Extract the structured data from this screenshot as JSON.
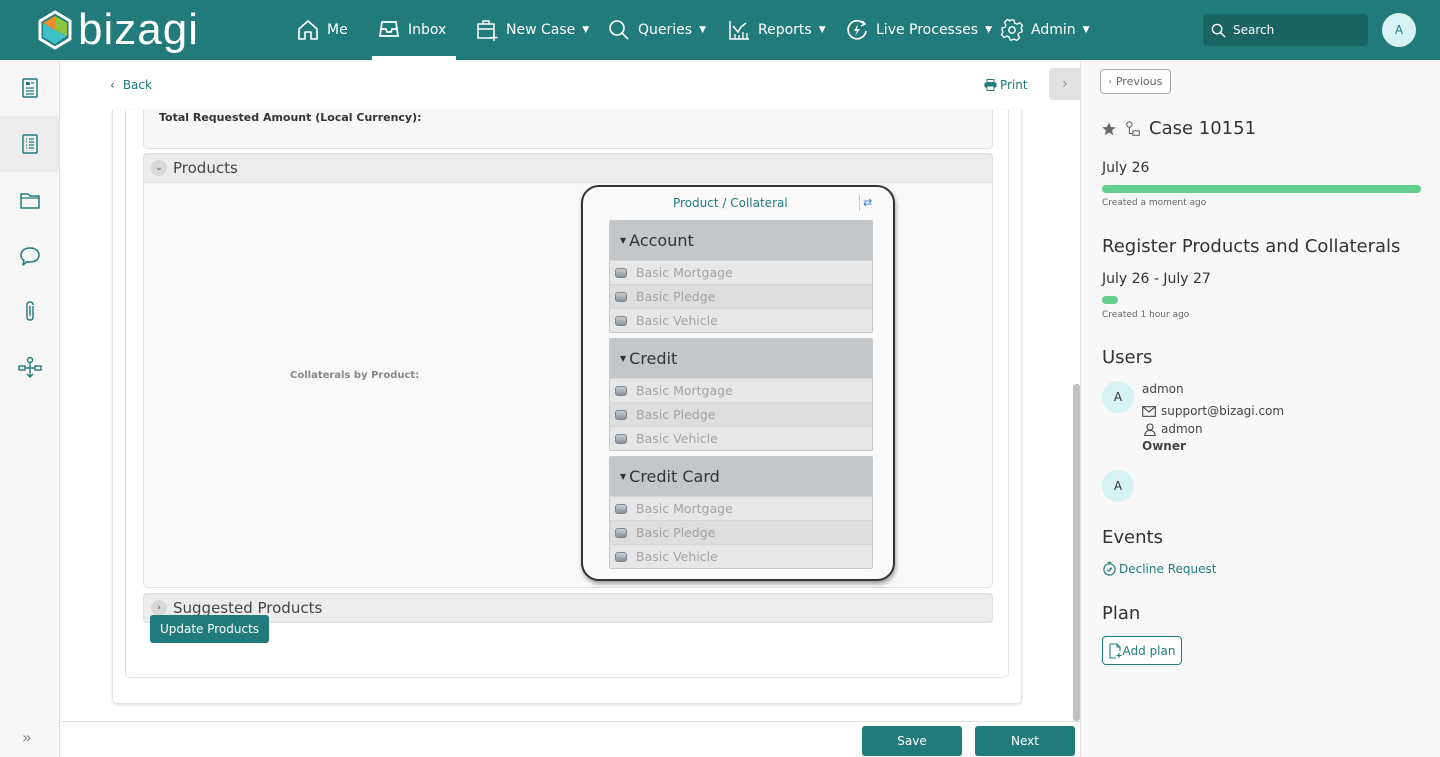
{
  "app": {
    "brand": "bizagi",
    "colors": {
      "primary": "#217b7b",
      "progress": "#63cd8d",
      "avatar_bg": "#d6f2f2"
    }
  },
  "nav": {
    "items": [
      {
        "label": "Me",
        "icon": "home-icon",
        "has_dropdown": false,
        "active": false
      },
      {
        "label": "Inbox",
        "icon": "inbox-icon",
        "has_dropdown": false,
        "active": true
      },
      {
        "label": "New Case",
        "icon": "new-case-icon",
        "has_dropdown": true,
        "active": false
      },
      {
        "label": "Queries",
        "icon": "search-icon",
        "has_dropdown": true,
        "active": false
      },
      {
        "label": "Reports",
        "icon": "reports-icon",
        "has_dropdown": true,
        "active": false
      },
      {
        "label": "Live Processes",
        "icon": "live-process-icon",
        "has_dropdown": true,
        "active": false
      },
      {
        "label": "Admin",
        "icon": "gear-icon",
        "has_dropdown": true,
        "active": false
      }
    ],
    "search_placeholder": "Search",
    "user_initial": "A",
    "caret": "▼"
  },
  "leftrail": {
    "items": [
      {
        "name": "form-icon",
        "active": false
      },
      {
        "name": "task-list-icon",
        "active": true
      },
      {
        "name": "folder-icon",
        "active": false
      },
      {
        "name": "comments-icon",
        "active": false
      },
      {
        "name": "attachment-icon",
        "active": false
      },
      {
        "name": "process-map-icon",
        "active": false
      }
    ],
    "expand_glyph": "»"
  },
  "main": {
    "back_label": "Back",
    "print_label": "Print",
    "total_amount_label": "Total Requested Amount (Local Currency):",
    "products_group": {
      "title": "Products",
      "expanded": true,
      "field_label": "Collaterals by Product:",
      "tree": {
        "title": "Product / Collateral",
        "swap_glyph": "⇄",
        "groups": [
          {
            "name": "Account",
            "items": [
              "Basic Mortgage",
              "Basic Pledge",
              "Basic Vehicle"
            ]
          },
          {
            "name": "Credit",
            "items": [
              "Basic Mortgage",
              "Basic Pledge",
              "Basic Vehicle"
            ]
          },
          {
            "name": "Credit Card",
            "items": [
              "Basic Mortgage",
              "Basic Pledge",
              "Basic Vehicle"
            ]
          }
        ]
      }
    },
    "suggested_group": {
      "title": "Suggested Products",
      "expanded": false
    },
    "update_button": "Update Products"
  },
  "footer": {
    "save_label": "Save",
    "next_label": "Next"
  },
  "rightpanel": {
    "previous_label": "Previous",
    "case_title": "Case 10151",
    "case_date": "July 26",
    "case_progress": 1.0,
    "case_created": "Created a moment ago",
    "task_title": "Register Products and Collaterals",
    "task_dates": "July 26 - July 27",
    "task_progress": 0.04,
    "task_created": "Created 1 hour ago",
    "users_heading": "Users",
    "users": [
      {
        "initial": "A",
        "name": "admon",
        "email": "support@bizagi.com",
        "username": "admon",
        "role": "Owner"
      },
      {
        "initial": "A"
      }
    ],
    "events_heading": "Events",
    "events": [
      {
        "label": "Decline Request"
      }
    ],
    "plan_heading": "Plan",
    "add_plan_label": "Add plan"
  }
}
